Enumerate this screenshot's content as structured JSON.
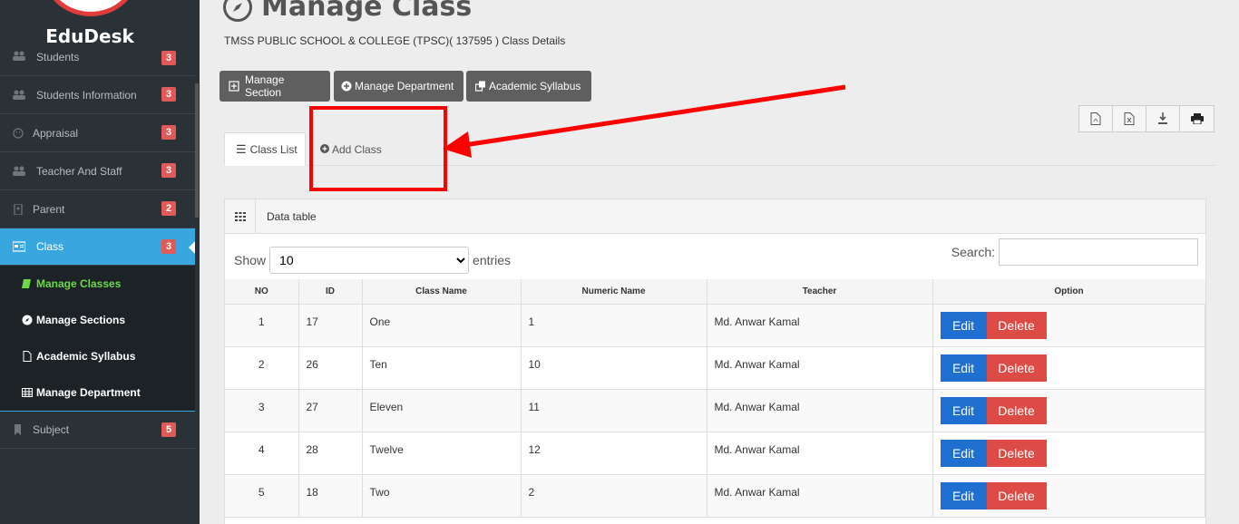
{
  "sidebar": {
    "brand": "EduDesk",
    "items": [
      {
        "label": "Students",
        "badge": "3",
        "icon": "users-icon"
      },
      {
        "label": "Students Information",
        "badge": "3",
        "icon": "users-icon"
      },
      {
        "label": "Appraisal",
        "badge": "3",
        "icon": "smile-icon"
      },
      {
        "label": "Teacher And Staff",
        "badge": "3",
        "icon": "users-icon"
      },
      {
        "label": "Parent",
        "badge": "2",
        "icon": "id-card-icon"
      },
      {
        "label": "Class",
        "badge": "3",
        "icon": "class-card-icon"
      },
      {
        "label": "Subject",
        "badge": "5",
        "icon": "bookmark-icon"
      }
    ],
    "subitems": [
      {
        "label": "Manage Classes",
        "icon": "book-icon"
      },
      {
        "label": "Manage Sections",
        "icon": "compass-icon"
      },
      {
        "label": "Academic Syllabus",
        "icon": "file-pdf-icon"
      },
      {
        "label": "Manage Department",
        "icon": "table-icon"
      }
    ]
  },
  "header": {
    "title": "Manage Class",
    "subtitle": "TMSS PUBLIC SCHOOL & COLLEGE (TPSC)( 137595 ) Class Details"
  },
  "toolbar": {
    "manage_section": "Manage Section",
    "manage_department": "Manage Department",
    "academic_syllabus": "Academic Syllabus"
  },
  "tabs": {
    "class_list": "Class List",
    "add_class": "Add Class"
  },
  "panel": {
    "title": "Data table",
    "show_label": "Show",
    "entries_value": "10",
    "entries_label": "entries",
    "search_label": "Search:"
  },
  "table": {
    "headers": [
      "NO",
      "ID",
      "Class Name",
      "Numeric Name",
      "Teacher",
      "Option"
    ],
    "rows": [
      {
        "no": "1",
        "id": "17",
        "name": "One",
        "numeric": "1",
        "teacher": "Md. Anwar Kamal"
      },
      {
        "no": "2",
        "id": "26",
        "name": "Ten",
        "numeric": "10",
        "teacher": "Md. Anwar Kamal"
      },
      {
        "no": "3",
        "id": "27",
        "name": "Eleven",
        "numeric": "11",
        "teacher": "Md. Anwar Kamal"
      },
      {
        "no": "4",
        "id": "28",
        "name": "Twelve",
        "numeric": "12",
        "teacher": "Md. Anwar Kamal"
      },
      {
        "no": "5",
        "id": "18",
        "name": "Two",
        "numeric": "2",
        "teacher": "Md. Anwar Kamal"
      }
    ],
    "edit_label": "Edit",
    "delete_label": "Delete"
  },
  "colors": {
    "sidebar_bg": "#2a3238",
    "active_blue": "#3aa6e0",
    "current_green": "#6ed84a",
    "edit_blue": "#1f6fd0",
    "delete_red": "#dc4b46",
    "annotation_red": "#ff0000"
  }
}
